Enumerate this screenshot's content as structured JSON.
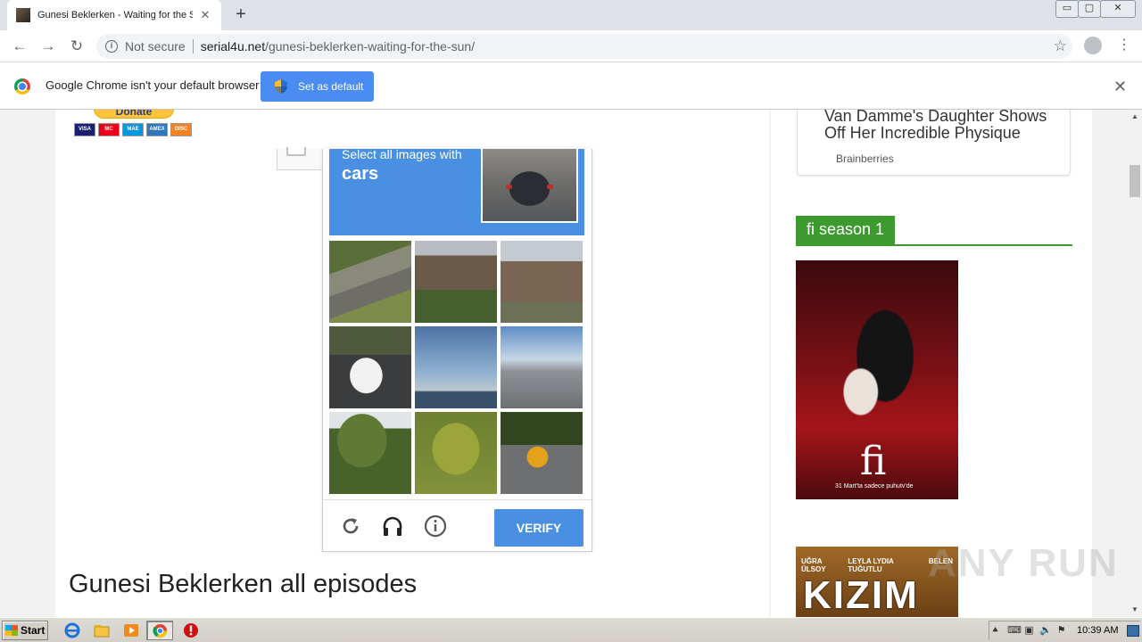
{
  "browser": {
    "tab_title": "Gunesi Beklerken - Waiting for the Sun",
    "tab_close": "✕",
    "new_tab": "+",
    "window_controls": [
      "▭",
      "▢",
      "✕"
    ],
    "address": {
      "security_label": "Not secure",
      "host": "serial4u.net",
      "path": "/gunesi-beklerken-waiting-for-the-sun/"
    }
  },
  "infobar": {
    "message": "Google Chrome isn't your default browser",
    "button_label": "Set as default",
    "close": "✕"
  },
  "page": {
    "donate_label": "Donate",
    "cards": [
      {
        "label": "VISA",
        "color": "#1a1f71"
      },
      {
        "label": "MC",
        "color": "#eb001b"
      },
      {
        "label": "MAE",
        "color": "#0099df"
      },
      {
        "label": "AMEX",
        "color": "#2e77bc"
      },
      {
        "label": "DISC",
        "color": "#f58220"
      }
    ],
    "heading": "Gunesi Beklerken all episodes"
  },
  "captcha": {
    "instruction": "Select all images with",
    "object": "cars",
    "verify_label": "VERIFY",
    "tiles": [
      "tile-1",
      "tile-2",
      "tile-3",
      "tile-4",
      "tile-5",
      "tile-6",
      "tile-7",
      "tile-8",
      "tile-9"
    ],
    "accent_color": "#4a90e2"
  },
  "sidebar": {
    "ad_title": "Van Damme's Daughter Shows Off Her Incredible Physique",
    "ad_source": "Brainberries",
    "section_title": "fi season 1",
    "section_color": "#3c9a2f",
    "poster1": {
      "title": "fi",
      "tagline": "31 Mart'ta sadece puhutv'de"
    },
    "poster2": {
      "cast": [
        "UĞRA ÜLSOY",
        "LEYLA LYDIA TUĞUTLU",
        "BELEN"
      ],
      "title": "KIZIM"
    }
  },
  "watermark": "ANY RUN",
  "taskbar": {
    "start_label": "Start",
    "clock": "10:39 AM"
  }
}
